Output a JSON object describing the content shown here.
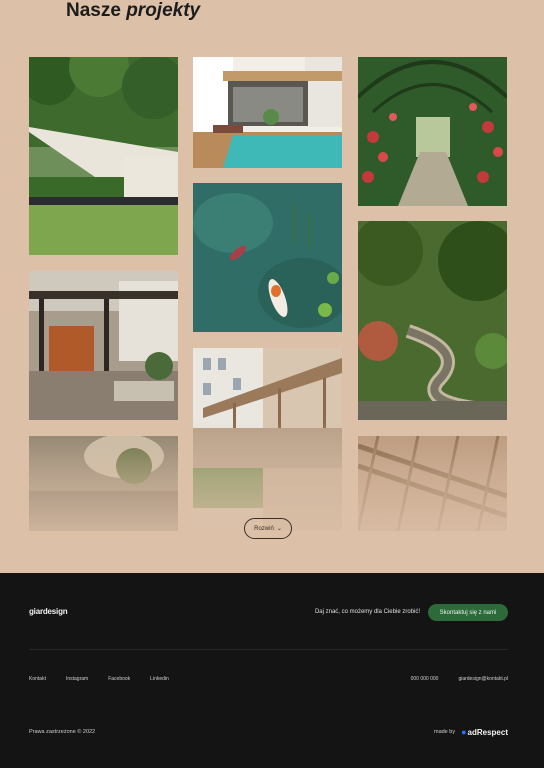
{
  "section": {
    "title_plain": "Nasze",
    "title_italic": "projekty",
    "more_button": "Rozwiń",
    "more_icon": "chevron-down-icon"
  },
  "gallery": [
    {
      "name": "garden-lawn-steps-photo",
      "colors": [
        "#4f7a3a",
        "#7fa85a",
        "#e7e2d6"
      ]
    },
    {
      "name": "pool-pergola-house-photo",
      "colors": [
        "#3fb3b3",
        "#c29a6a",
        "#f2efe8"
      ]
    },
    {
      "name": "rose-arch-tunnel-photo",
      "colors": [
        "#2f5a2a",
        "#c23a3a",
        "#a9a08a"
      ]
    },
    {
      "name": "koi-pond-photo",
      "colors": [
        "#2a6a62",
        "#3e8a7a",
        "#e0702a"
      ]
    },
    {
      "name": "tropical-garden-path-photo",
      "colors": [
        "#3a5a2a",
        "#8a8270",
        "#c4b8a0"
      ]
    },
    {
      "name": "wooden-pergola-terrace-photo",
      "colors": [
        "#3a302a",
        "#6a5040",
        "#b0a496"
      ]
    },
    {
      "name": "timber-pergola-courtyard-photo",
      "colors": [
        "#c9b49a",
        "#8a6a4a",
        "#eee"
      ]
    },
    {
      "name": "concrete-steps-garden-photo",
      "colors": [
        "#7a7060",
        "#a09070",
        "#4a5a3a"
      ]
    },
    {
      "name": "pergola-beams-closeup-photo",
      "colors": [
        "#8a6a4a",
        "#c9a888",
        "#dccab4"
      ]
    }
  ],
  "footer": {
    "logo": "giardesign",
    "cta_text": "Daj znać, co możemy dla Ciebie zrobić!",
    "cta_button": "Skontaktuj się z nami",
    "links": [
      "Kontakt",
      "Instagram",
      "Facebook",
      "Linkedin"
    ],
    "phone": "000 000 000",
    "email": "giardesign@kontakt.pl",
    "copyright": "Prawa zastrzeżone © 2022",
    "made_by_label": "made by",
    "made_by_brand": "adRespect",
    "colors": {
      "background": "#141414",
      "accent": "#2d6a3a",
      "page": "#dcc0a8"
    }
  }
}
